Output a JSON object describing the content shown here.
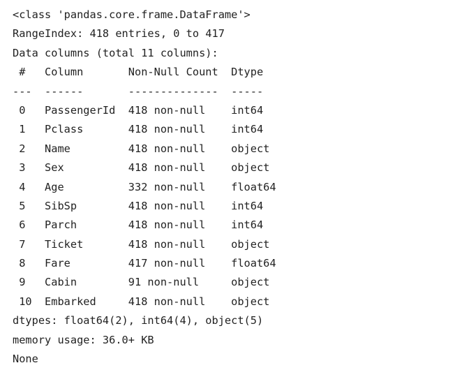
{
  "output": {
    "class_line": "<class 'pandas.core.frame.DataFrame'>",
    "range_index": "RangeIndex: 418 entries, 0 to 417",
    "data_columns": "Data columns (total 11 columns):",
    "header_line": " #   Column       Non-Null Count  Dtype  ",
    "separator_line": "---  ------       --------------  -----  ",
    "rows": [
      " 0   PassengerId  418 non-null    int64  ",
      " 1   Pclass       418 non-null    int64  ",
      " 2   Name         418 non-null    object ",
      " 3   Sex          418 non-null    object ",
      " 4   Age          332 non-null    float64",
      " 5   SibSp        418 non-null    int64  ",
      " 6   Parch        418 non-null    int64  ",
      " 7   Ticket       418 non-null    object ",
      " 8   Fare         417 non-null    float64",
      " 9   Cabin        91 non-null     object ",
      " 10  Embarked     418 non-null    object "
    ],
    "dtypes_line": "dtypes: float64(2), int64(4), object(5)",
    "memory_line": "memory usage: 36.0+ KB",
    "return_value": "None"
  }
}
